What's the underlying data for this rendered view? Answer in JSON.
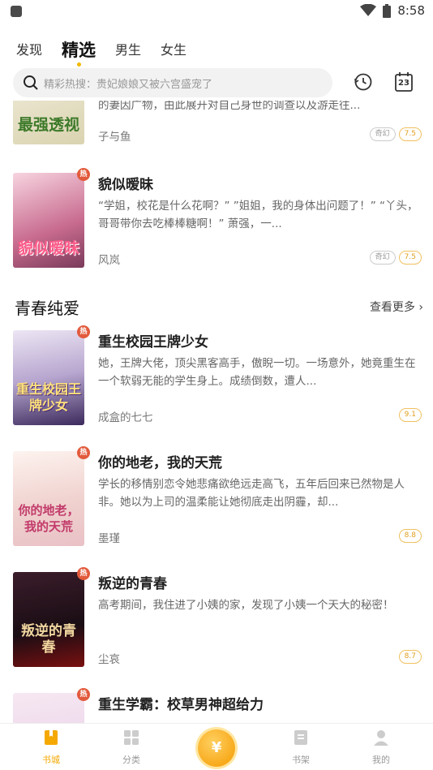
{
  "status": {
    "time": "8:58"
  },
  "tabs": [
    {
      "label": "发现",
      "active": false
    },
    {
      "label": "精选",
      "active": true
    },
    {
      "label": "男生",
      "active": false
    },
    {
      "label": "女生",
      "active": false
    }
  ],
  "search": {
    "placeholder": "精彩热搜：贵妃娘娘又被六宫盛宠了",
    "date_badge": "23"
  },
  "books_top": [
    {
      "cover_text": "最强透视",
      "title": "",
      "desc": "的妻因广物，由此展开对自己身世的调查以及游走往...",
      "author": "子与鱼",
      "tag": "奇幻",
      "score": "7.5"
    },
    {
      "cover_text": "貌似暧昧",
      "hot": "热",
      "title": "貌似暧昧",
      "desc": "“学姐，校花是什么花啊？” ”姐姐，我的身体出问题了！” “丫头，哥哥带你去吃棒棒糖啊！” 萧强，一...",
      "author": "风岚",
      "tag": "奇幻",
      "score": "7.5"
    }
  ],
  "section": {
    "title": "青春纯爱",
    "more": "查看更多"
  },
  "books_section": [
    {
      "cover_text": "重生校园王牌少女",
      "hot": "热",
      "title": "重生校园王牌少女",
      "desc": "她，王牌大佬，顶尖黑客高手，傲睨一切。一场意外，她竟重生在一个软弱无能的学生身上。成绩倒数，遭人...",
      "author": "成盒的七七",
      "score": "9.1"
    },
    {
      "cover_text": "你的地老，我的天荒",
      "hot": "热",
      "title": "你的地老，我的天荒",
      "desc": "学长的移情别恋令她悲痛欲绝远走高飞，五年后回来已然物是人非。她以为上司的温柔能让她彻底走出阴霾，却...",
      "author": "墨瑾",
      "score": "8.8"
    },
    {
      "cover_text": "叛逆的青春",
      "hot": "热",
      "title": "叛逆的青春",
      "desc": "高考期间，我住进了小姨的家，发现了小姨一个天大的秘密！",
      "author": "尘哀",
      "score": "8.7"
    },
    {
      "cover_text": "",
      "hot": "热",
      "title": "重生学霸：校草男神超给力",
      "desc": "",
      "author": "",
      "score": ""
    }
  ],
  "nav": [
    {
      "label": "书城",
      "icon": "book-store-icon",
      "active": true
    },
    {
      "label": "分类",
      "icon": "category-icon",
      "active": false
    },
    {
      "label": "",
      "icon": "coin-icon",
      "active": false
    },
    {
      "label": "书架",
      "icon": "bookshelf-icon",
      "active": false
    },
    {
      "label": "我的",
      "icon": "profile-icon",
      "active": false
    }
  ],
  "coin_symbol": "¥",
  "colors": {
    "accent": "#f5a800",
    "hot": "#e25a3c"
  }
}
